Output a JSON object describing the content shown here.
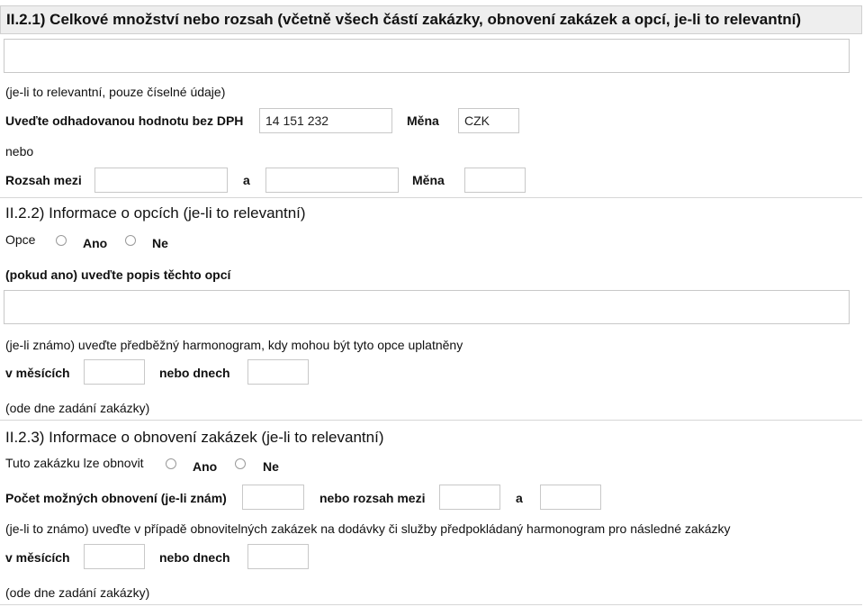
{
  "s1": {
    "heading": "II.2.1) Celkové množství nebo rozsah (včetně všech částí zakázky, obnovení zakázek a opcí, je-li to relevantní)",
    "note": "(je-li to relevantní, pouze číselné údaje)",
    "value_label": "Uveďte odhadovanou hodnotu bez DPH",
    "value": "14 151 232",
    "currency_label": "Měna",
    "currency": "CZK",
    "or": "nebo",
    "range_label": "Rozsah mezi",
    "and": "a",
    "currency_label2": "Měna"
  },
  "s2": {
    "heading": "II.2.2) Informace o opcích (je-li to relevantní)",
    "options_label": "Opce",
    "yes": "Ano",
    "no": "Ne",
    "desc_label": "(pokud ano) uveďte popis těchto opcí",
    "timeline_note": "(je-li známo) uveďte předběžný harmonogram, kdy mohou být tyto opce uplatněny",
    "months_label": "v měsících",
    "days_label": "nebo dnech",
    "from_note": "(ode dne zadání zakázky)"
  },
  "s3": {
    "heading": "II.2.3) Informace o obnovení zakázek (je-li to relevantní)",
    "renew_label": "Tuto zakázku lze obnovit",
    "yes": "Ano",
    "no": "Ne",
    "count_label": "Počet možných obnovení (je-li znám)",
    "range_label": "nebo rozsah mezi",
    "and": "a",
    "timeline_note": "(je-li to známo) uveďte v případě obnovitelných zakázek na dodávky či služby předpokládaný harmonogram pro následné zakázky",
    "months_label": "v měsících",
    "days_label": "nebo dnech",
    "from_note": "(ode dne zadání zakázky)"
  }
}
